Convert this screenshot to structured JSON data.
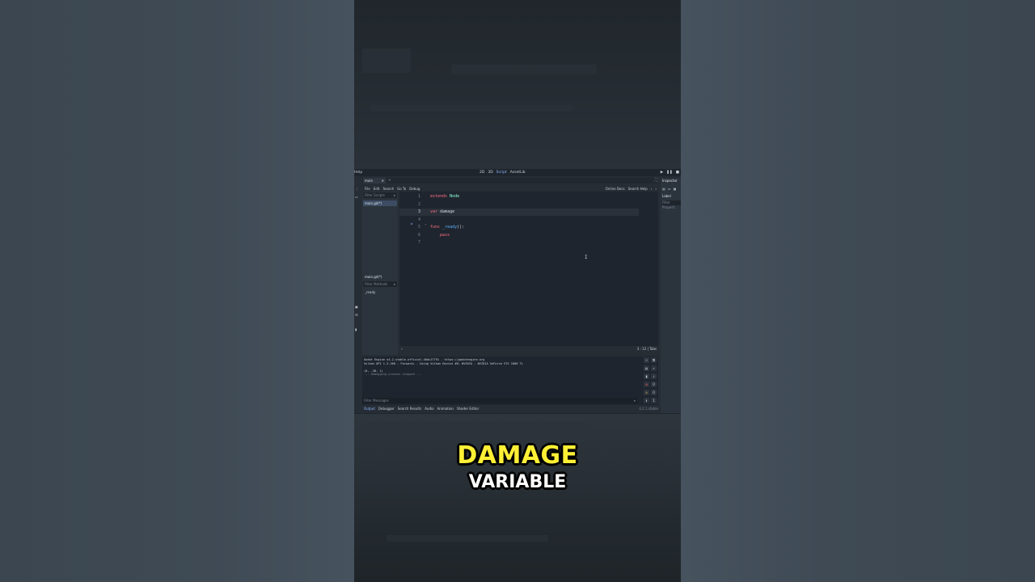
{
  "topbar": {
    "help": "Help",
    "modes": [
      "2D",
      "3D",
      "Script",
      "AssetLib"
    ],
    "active_mode": "Script"
  },
  "tabs": [
    {
      "label": "main",
      "close": "✕"
    }
  ],
  "menu": {
    "items": [
      "File",
      "Edit",
      "Search",
      "Go To",
      "Debug"
    ],
    "online_docs": "Online Docs",
    "search_help": "Search Help"
  },
  "scripts_panel": {
    "filter_placeholder": "Filter Scripts",
    "script_item": "main.gd(*)",
    "current_script": "main.gd(*)",
    "methods_filter_placeholder": "Filter Methods",
    "methods": [
      "_ready"
    ]
  },
  "code": {
    "lines": [
      {
        "n": "1",
        "tokens": [
          {
            "t": "extends",
            "c": "kw"
          },
          {
            "t": " "
          },
          {
            "t": "Node",
            "c": "cls"
          }
        ]
      },
      {
        "n": "2",
        "tokens": []
      },
      {
        "n": "3",
        "tokens": [
          {
            "t": "var",
            "c": "kw"
          },
          {
            "t": " damage"
          }
        ]
      },
      {
        "n": "4",
        "tokens": []
      },
      {
        "n": "5",
        "tokens": [
          {
            "t": "func",
            "c": "kw"
          },
          {
            "t": " "
          },
          {
            "t": "_ready",
            "c": "fn"
          },
          {
            "t": "():"
          }
        ]
      },
      {
        "n": "6",
        "tokens": [
          {
            "t": "    "
          },
          {
            "t": "pass",
            "c": "kw"
          }
        ]
      },
      {
        "n": "7",
        "tokens": []
      }
    ],
    "current_line": 3,
    "status": "3 :   12  |  Tabs"
  },
  "inspector": {
    "title": "Inspector",
    "label_item": "Label",
    "filter_placeholder": "Filter Properti"
  },
  "output": {
    "messages": [
      {
        "text": "Godot Engine v4.2.stable.official.46dc27791 - https://godotengine.org",
        "dim": false
      },
      {
        "text": "Vulkan API 1.3.260 - Forward+ - Using Vulkan Device #0: NVIDIA - NVIDIA GeForce GTX 1080 Ti",
        "dim": false
      },
      {
        "text": "",
        "dim": false
      },
      {
        "text": "(0, -30, 1)",
        "dim": false
      },
      {
        "text": "--- Debugging process stopped ---",
        "dim": true
      }
    ],
    "filter_placeholder": "Filter Messages"
  },
  "bottom_tabs": [
    "Output",
    "Debugger",
    "Search Results",
    "Audio",
    "Animation",
    "Shader Editor"
  ],
  "active_bottom_tab": "Output",
  "version": "4.2.1.stable",
  "captions": {
    "line1": "DAMAGE",
    "line2": "VARIABLE"
  },
  "colors": {
    "keyword": "#ff7085",
    "class": "#8effda",
    "function": "#57b3ff",
    "caption_yellow": "#fff035"
  }
}
